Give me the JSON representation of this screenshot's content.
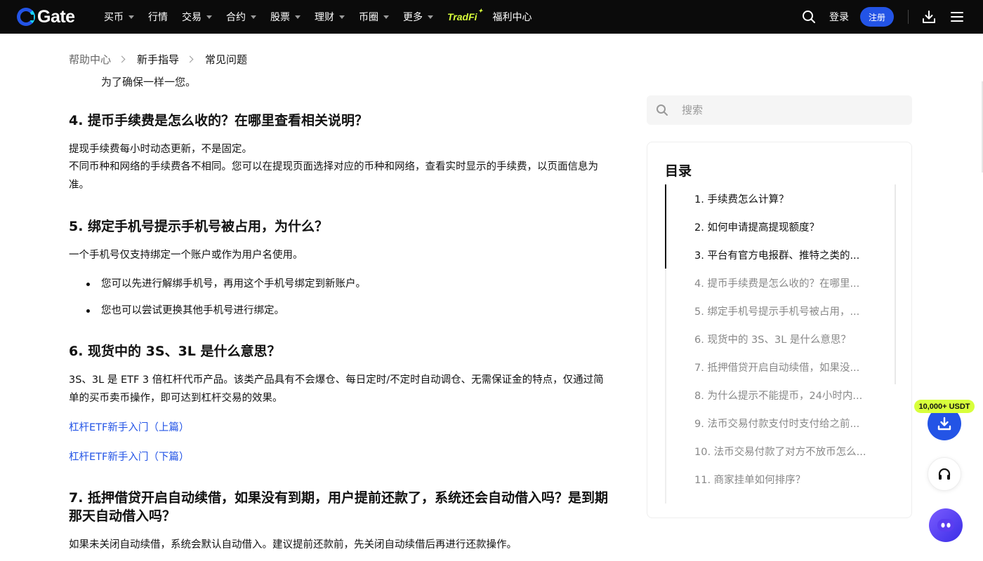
{
  "header": {
    "logo_text": "Gate",
    "nav": [
      {
        "label": "买币",
        "has_dropdown": true
      },
      {
        "label": "行情",
        "has_dropdown": false
      },
      {
        "label": "交易",
        "has_dropdown": true
      },
      {
        "label": "合约",
        "has_dropdown": true
      },
      {
        "label": "股票",
        "has_dropdown": true
      },
      {
        "label": "理财",
        "has_dropdown": true
      },
      {
        "label": "币圈",
        "has_dropdown": true
      },
      {
        "label": "更多",
        "has_dropdown": true
      }
    ],
    "tradfi_label": "TradFi",
    "welfare_label": "福利中心",
    "login_label": "登录",
    "register_label": "注册"
  },
  "breadcrumb": [
    "帮助中心",
    "新手指导",
    "常见问题"
  ],
  "article": {
    "cut_text": "为了确保一样一您。",
    "sections": [
      {
        "heading": "4. 提币手续费是怎么收的？在哪里查看相关说明？",
        "paragraphs": [
          "提现手续费每小时动态更新，不是固定。",
          "不同币种和网络的手续费各不相同。您可以在提现页面选择对应的币种和网络，查看实时显示的手续费，以页面信息为准。"
        ]
      },
      {
        "heading": "5. 绑定手机号提示手机号被占用，为什么？",
        "paragraphs": [
          "一个手机号仅支持绑定一个账户或作为用户名使用。"
        ],
        "bullets": [
          "您可以先进行解绑手机号，再用这个手机号绑定到新账户。",
          "您也可以尝试更换其他手机号进行绑定。"
        ]
      },
      {
        "heading": "6. 现货中的 3S、3L 是什么意思？",
        "paragraphs": [
          "3S、3L 是 ETF 3 倍杠杆代币产品。该类产品具有不会爆仓、每日定时/不定时自动调仓、无需保证金的特点，仅通过简单的买币卖币操作，即可达到杠杆交易的效果。"
        ],
        "links": [
          "杠杆ETF新手入门（上篇）",
          "杠杆ETF新手入门（下篇）"
        ]
      },
      {
        "heading": "7. 抵押借贷开启自动续借，如果没有到期，用户提前还款了，系统还会自动借入吗？是到期那天自动借入吗？",
        "paragraphs": [
          "如果未关闭自动续借，系统会默认自动借入。建议提前还款前，先关闭自动续借后再进行还款操作。"
        ]
      }
    ]
  },
  "search": {
    "placeholder": "搜索"
  },
  "toc": {
    "title": "目录",
    "active_through": 3,
    "items": [
      "1. 手续费怎么计算？",
      "2. 如何申请提高提现额度？",
      "3. 平台有官方电报群、推特之类的...",
      "4. 提币手续费是怎么收的？在哪里...",
      "5. 绑定手机号提示手机号被占用，...",
      "6. 现货中的 3S、3L 是什么意思？",
      "7. 抵押借贷开启自动续借，如果没...",
      "8. 为什么提示不能提币，24小时内...",
      "9. 法币交易付款支付时支付给之前...",
      "10. 法币交易付款了对方不放币怎么...",
      "11. 商家挂单如何排序？"
    ]
  },
  "floating": {
    "promo_label": "10,000+ USDT"
  },
  "colors": {
    "brand_blue": "#2354e6",
    "promo_lime": "#d8ff3b",
    "nav_bg": "#0b0b0b"
  }
}
